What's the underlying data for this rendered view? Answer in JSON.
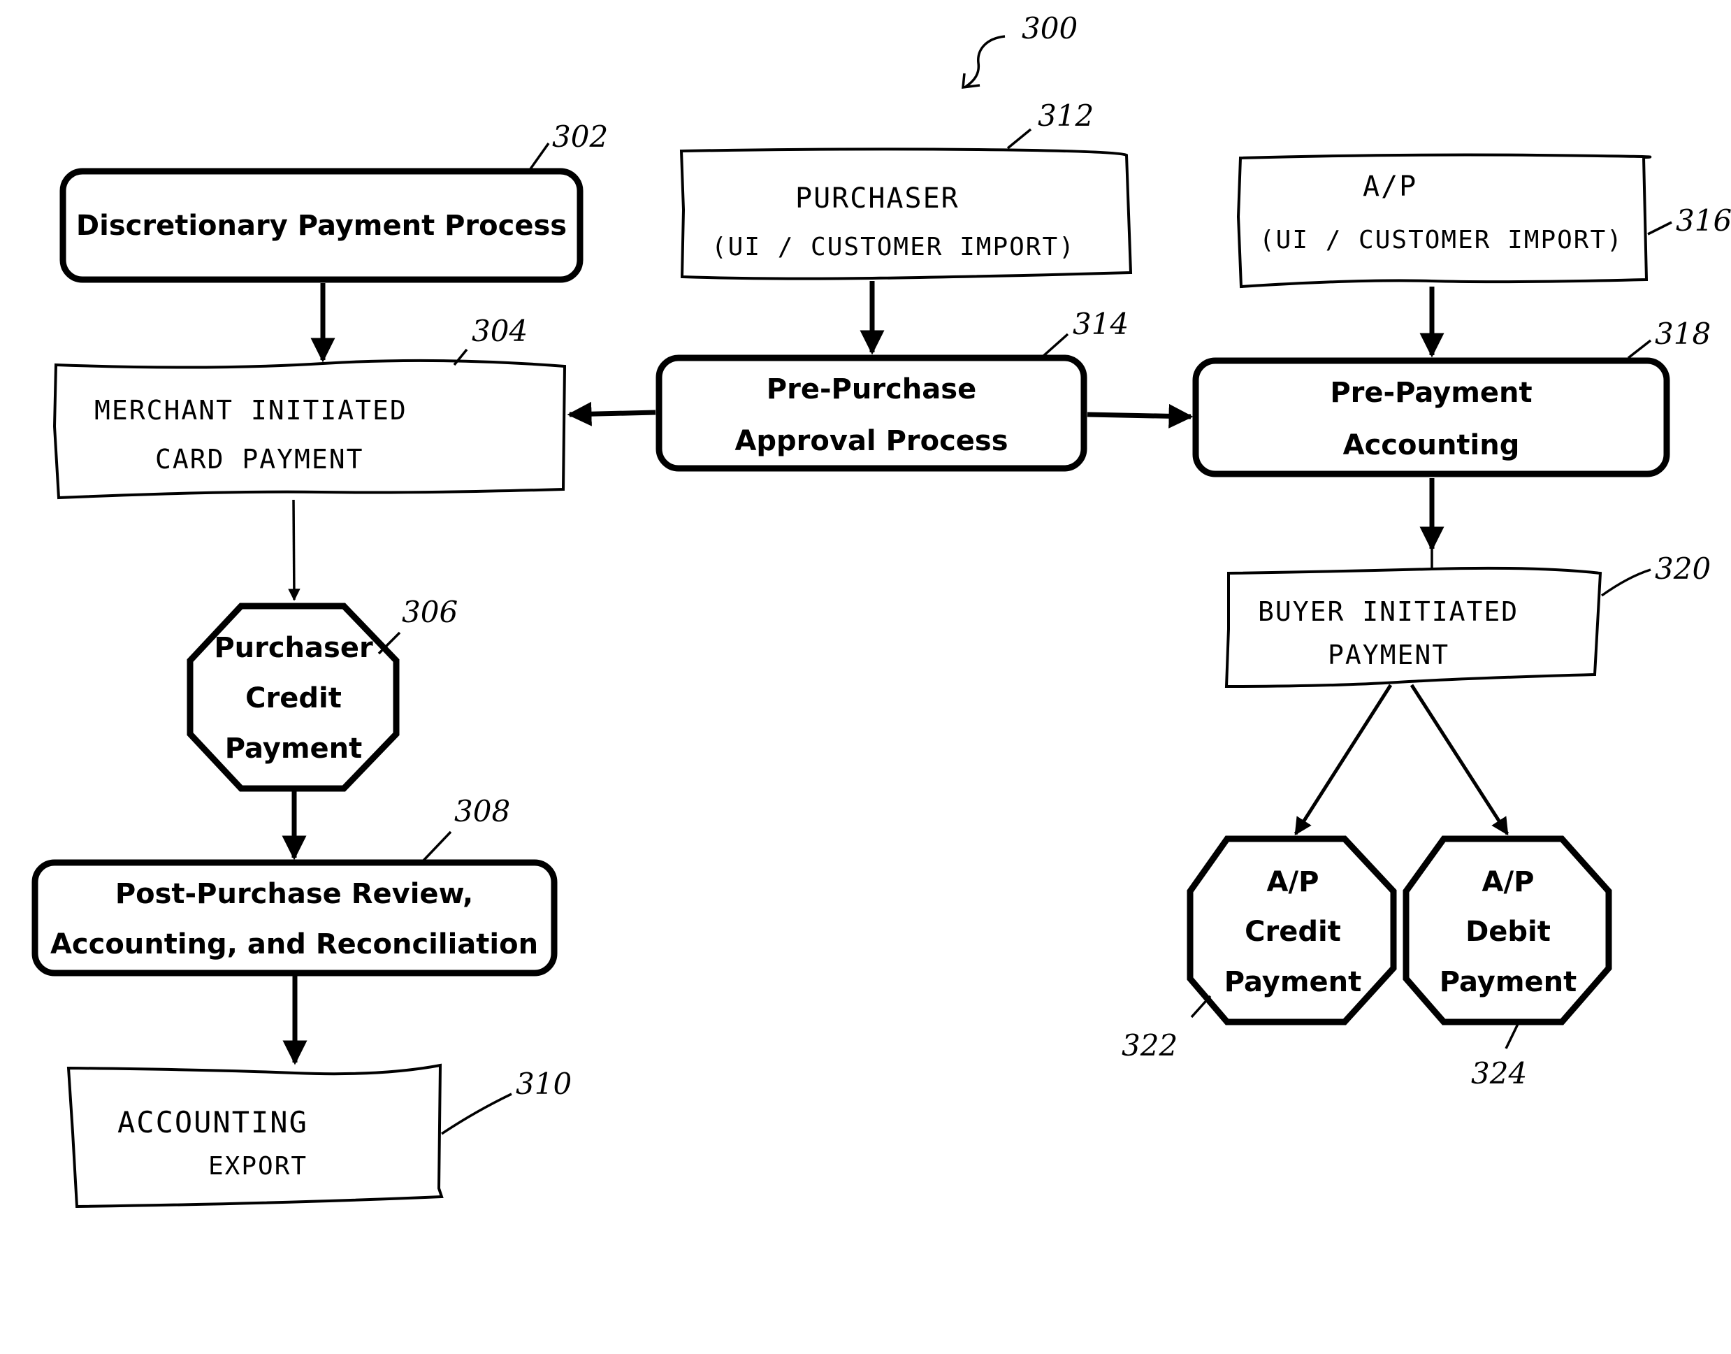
{
  "figure": {
    "reference": "300",
    "colors": {
      "ink": "#000000",
      "paper": "#ffffff"
    }
  },
  "nodes": {
    "n302": {
      "ref": "302",
      "style": "rounded-bold",
      "lines": [
        "Discretionary Payment Process"
      ]
    },
    "n304": {
      "ref": "304",
      "style": "handwritten",
      "lines": [
        "MERCHANT INITIATED",
        "CARD PAYMENT"
      ]
    },
    "n306": {
      "ref": "306",
      "style": "octagon",
      "lines": [
        "Purchaser",
        "Credit",
        "Payment"
      ]
    },
    "n308": {
      "ref": "308",
      "style": "rounded-bold",
      "lines": [
        "Post-Purchase Review,",
        "Accounting, and Reconciliation"
      ]
    },
    "n310": {
      "ref": "310",
      "style": "handwritten",
      "lines": [
        "ACCOUNTING",
        "EXPORT"
      ]
    },
    "n312": {
      "ref": "312",
      "style": "handwritten",
      "lines": [
        "PURCHASER",
        "(UI / CUSTOMER IMPORT)"
      ]
    },
    "n314": {
      "ref": "314",
      "style": "rounded-bold",
      "lines": [
        "Pre-Purchase",
        "Approval Process"
      ]
    },
    "n316": {
      "ref": "316",
      "style": "handwritten",
      "lines": [
        "A/P",
        "(UI / CUSTOMER IMPORT)"
      ]
    },
    "n318": {
      "ref": "318",
      "style": "rounded-bold",
      "lines": [
        "Pre-Payment",
        "Accounting"
      ]
    },
    "n320": {
      "ref": "320",
      "style": "handwritten",
      "lines": [
        "BUYER INITIATED",
        "PAYMENT"
      ]
    },
    "n322": {
      "ref": "322",
      "style": "octagon",
      "lines": [
        "A/P",
        "Credit",
        "Payment"
      ]
    },
    "n324": {
      "ref": "324",
      "style": "octagon",
      "lines": [
        "A/P",
        "Debit",
        "Payment"
      ]
    }
  },
  "edges": [
    {
      "from": "302",
      "to": "304"
    },
    {
      "from": "314",
      "to": "304"
    },
    {
      "from": "312",
      "to": "314"
    },
    {
      "from": "314",
      "to": "318"
    },
    {
      "from": "316",
      "to": "318"
    },
    {
      "from": "318",
      "to": "320"
    },
    {
      "from": "304",
      "to": "306"
    },
    {
      "from": "306",
      "to": "308"
    },
    {
      "from": "308",
      "to": "310"
    },
    {
      "from": "320",
      "to": "322"
    },
    {
      "from": "320",
      "to": "324"
    }
  ]
}
